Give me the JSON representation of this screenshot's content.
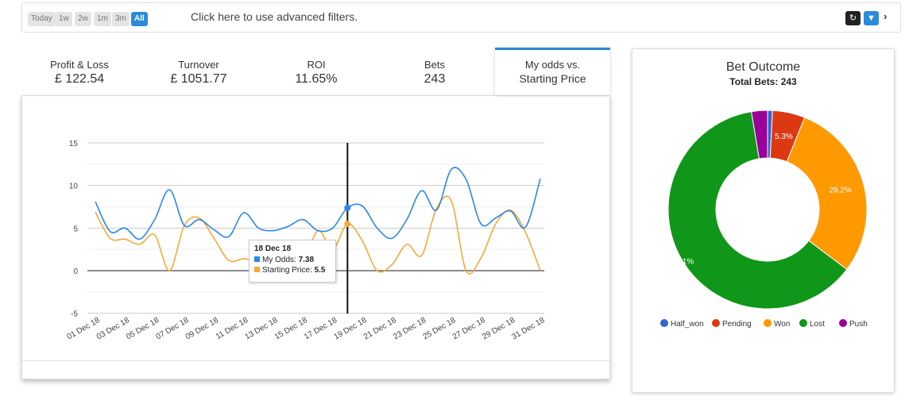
{
  "filters": {
    "ranges": [
      "Today",
      "1w",
      "2w",
      "1m",
      "3m",
      "All"
    ],
    "active": "All",
    "advanced_label": "Click here to use advanced filters.",
    "icons": [
      "refresh-icon",
      "filter-icon",
      "chevron-right-icon"
    ]
  },
  "tabs": [
    {
      "label": "Profit & Loss",
      "value": "£ 122.54"
    },
    {
      "label": "Turnover",
      "value": "£ 1051.77"
    },
    {
      "label": "ROI",
      "value": "11.65%"
    },
    {
      "label": "Bets",
      "value": "243"
    },
    {
      "label": "My odds vs.",
      "value": "Starting Price",
      "active": true
    }
  ],
  "colors": {
    "accent": "#2a8bd8",
    "my_odds": "#2f86e6",
    "starting_price": "#f4a93a"
  },
  "tooltip": {
    "date": "18 Dec 18",
    "my_odds_label": "My Odds:",
    "my_odds_value": "7.38",
    "sp_label": "Starting Price:",
    "sp_value": "5.5"
  },
  "chart_data": [
    {
      "type": "line",
      "x": [
        "01 Dec 18",
        "02 Dec 18",
        "03 Dec 18",
        "04 Dec 18",
        "05 Dec 18",
        "06 Dec 18",
        "07 Dec 18",
        "08 Dec 18",
        "09 Dec 18",
        "10 Dec 18",
        "11 Dec 18",
        "12 Dec 18",
        "13 Dec 18",
        "14 Dec 18",
        "15 Dec 18",
        "16 Dec 18",
        "17 Dec 18",
        "18 Dec 18",
        "19 Dec 18",
        "20 Dec 18",
        "21 Dec 18",
        "22 Dec 18",
        "23 Dec 18",
        "24 Dec 18",
        "25 Dec 18",
        "26 Dec 18",
        "27 Dec 18",
        "28 Dec 18",
        "29 Dec 18",
        "30 Dec 18",
        "31 Dec 18"
      ],
      "xticks": [
        "01 Dec 18",
        "03 Dec 18",
        "05 Dec 18",
        "07 Dec 18",
        "09 Dec 18",
        "11 Dec 18",
        "13 Dec 18",
        "15 Dec 18",
        "17 Dec 18",
        "19 Dec 18",
        "21 Dec 18",
        "23 Dec 18",
        "25 Dec 18",
        "27 Dec 18",
        "29 Dec 18",
        "31 Dec 18"
      ],
      "yticks": [
        15,
        10,
        5,
        0,
        -5
      ],
      "ylim": [
        -5,
        15
      ],
      "grid": true,
      "crosshair": "18 Dec 18",
      "series": [
        {
          "name": "My Odds",
          "color": "#2f86e6",
          "values": [
            8.1,
            4.6,
            5.0,
            3.7,
            6.0,
            9.5,
            5.3,
            6.0,
            4.8,
            4.0,
            6.8,
            5.0,
            4.7,
            5.2,
            6.0,
            4.7,
            5.0,
            7.38,
            7.6,
            5.0,
            3.8,
            6.0,
            9.4,
            7.1,
            11.9,
            10.7,
            5.5,
            6.2,
            7.0,
            5.1,
            10.8
          ]
        },
        {
          "name": "Starting Price",
          "color": "#f4a93a",
          "values": [
            6.9,
            3.8,
            3.7,
            3.1,
            4.2,
            0,
            5.3,
            6.2,
            3.8,
            1.2,
            1.4,
            1.0,
            1.2,
            1.0,
            0.8,
            4.7,
            2.5,
            5.5,
            3.5,
            0,
            0.7,
            3.1,
            1.8,
            7.3,
            8.2,
            0,
            1.5,
            5.5,
            7.1,
            4.5,
            0
          ]
        }
      ]
    },
    {
      "type": "pie",
      "title": "Bet Outcome",
      "subtitle": "Total Bets: 243",
      "legend": "bottom",
      "slices": [
        {
          "name": "Half_won",
          "value": 0.8,
          "color": "#3366cc",
          "label": ""
        },
        {
          "name": "Pending",
          "value": 5.3,
          "color": "#dc3912",
          "label": "5.3%"
        },
        {
          "name": "Won",
          "value": 29.2,
          "color": "#ff9900",
          "label": "29.2%"
        },
        {
          "name": "Lost",
          "value": 62.1,
          "color": "#109618",
          "label": "62.1%"
        },
        {
          "name": "Push",
          "value": 2.6,
          "color": "#990099",
          "label": ""
        }
      ]
    }
  ]
}
